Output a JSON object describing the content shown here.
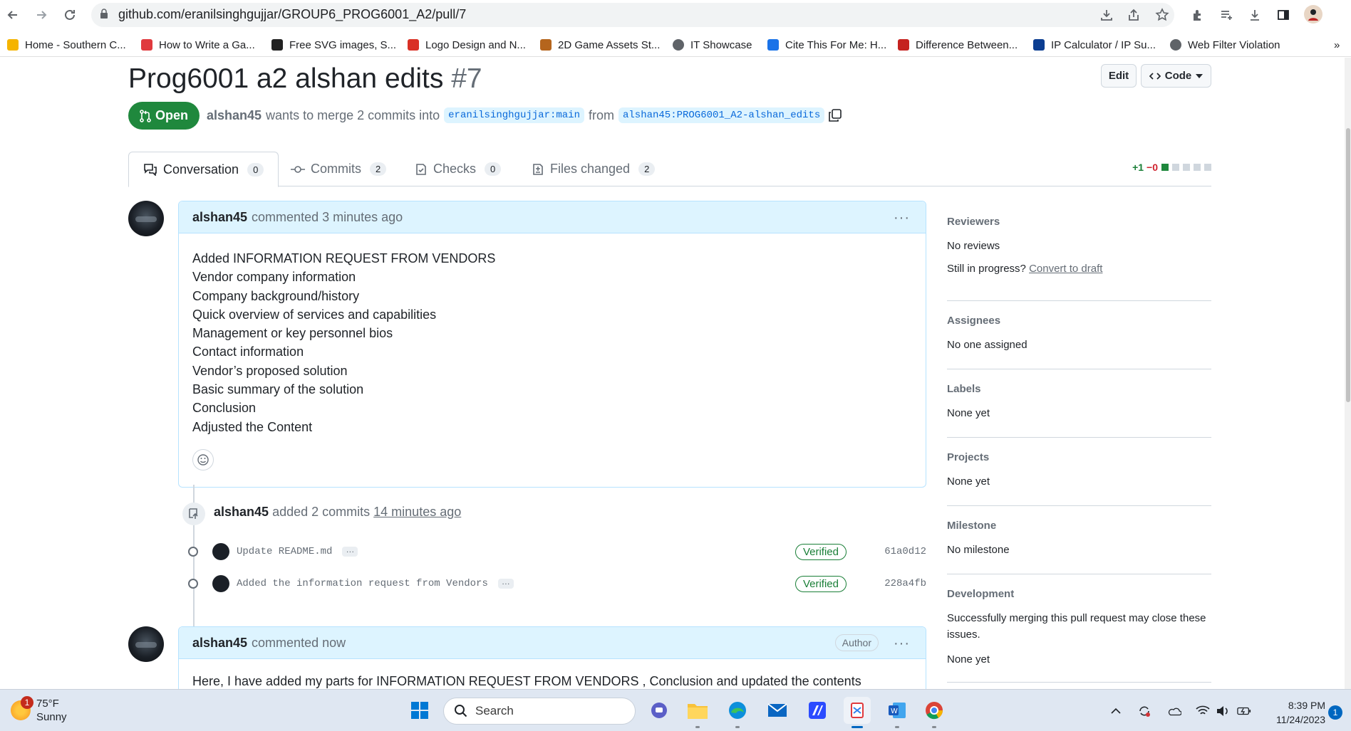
{
  "browser": {
    "url": "github.com/eranilsinghgujjar/GROUP6_PROG6001_A2/pull/7",
    "bookmarks": [
      {
        "label": "Home - Southern C...",
        "color": "#f5b400"
      },
      {
        "label": "How to Write a Ga...",
        "color": "#e03a3e"
      },
      {
        "label": "Free SVG images, S...",
        "color": "#222222"
      },
      {
        "label": "Logo Design and N...",
        "color": "#d93025"
      },
      {
        "label": "2D Game Assets St...",
        "color": "#b5651d"
      },
      {
        "label": "IT Showcase",
        "color": "#5f6368"
      },
      {
        "label": "Cite This For Me: H...",
        "color": "#1a73e8"
      },
      {
        "label": "Difference Between...",
        "color": "#c5221f"
      },
      {
        "label": "IP Calculator / IP Su...",
        "color": "#0b3d91"
      },
      {
        "label": "Web Filter Violation",
        "color": "#5f6368"
      }
    ],
    "overflow": "»"
  },
  "pr": {
    "title": "Prog6001 a2 alshan edits",
    "number": "#7",
    "state": "Open",
    "edit_label": "Edit",
    "code_label": "Code",
    "author": "alshan45",
    "merge_text": "wants to merge 2 commits into",
    "base_branch": "eranilsinghgujjar:main",
    "from_text": "from",
    "head_branch": "alshan45:PROG6001_A2-alshan_edits"
  },
  "tabs": [
    {
      "label": "Conversation",
      "count": "0"
    },
    {
      "label": "Commits",
      "count": "2"
    },
    {
      "label": "Checks",
      "count": "0"
    },
    {
      "label": "Files changed",
      "count": "2"
    }
  ],
  "diffstat": {
    "additions": "+1",
    "deletions": "−0"
  },
  "comment1": {
    "author": "alshan45",
    "meta": "commented 3 minutes ago",
    "lines": [
      "Added INFORMATION REQUEST FROM VENDORS",
      "Vendor company information",
      "Company background/history",
      "Quick overview of services and capabilities",
      "Management or key personnel bios",
      "Contact information",
      "Vendor’s proposed solution",
      "Basic summary of the solution",
      "Conclusion",
      "Adjusted the Content"
    ]
  },
  "commits_event": {
    "author": "alshan45",
    "text": "added 2 commits",
    "time": "14 minutes ago",
    "commits": [
      {
        "message": "Update README.md",
        "status": "Verified",
        "sha": "61a0d12"
      },
      {
        "message": "Added the information request from Vendors",
        "status": "Verified",
        "sha": "228a4fb"
      }
    ]
  },
  "comment2": {
    "author": "alshan45",
    "meta": "commented now",
    "badge": "Author",
    "body": "Here, I have added my parts for INFORMATION REQUEST FROM VENDORS , Conclusion and updated the contents"
  },
  "sidebar": {
    "reviewers": {
      "heading": "Reviewers",
      "value": "No reviews",
      "progress_q": "Still in progress?",
      "progress_link": "Convert to draft"
    },
    "assignees": {
      "heading": "Assignees",
      "value": "No one assigned"
    },
    "labels": {
      "heading": "Labels",
      "value": "None yet"
    },
    "projects": {
      "heading": "Projects",
      "value": "None yet"
    },
    "milestone": {
      "heading": "Milestone",
      "value": "No milestone"
    },
    "development": {
      "heading": "Development",
      "text": "Successfully merging this pull request may close these issues.",
      "value": "None yet"
    }
  },
  "taskbar": {
    "temp": "75°F",
    "condition": "Sunny",
    "weather_badge": "1",
    "search_placeholder": "Search",
    "time": "8:39 PM",
    "date": "11/24/2023",
    "notifications": "1"
  }
}
